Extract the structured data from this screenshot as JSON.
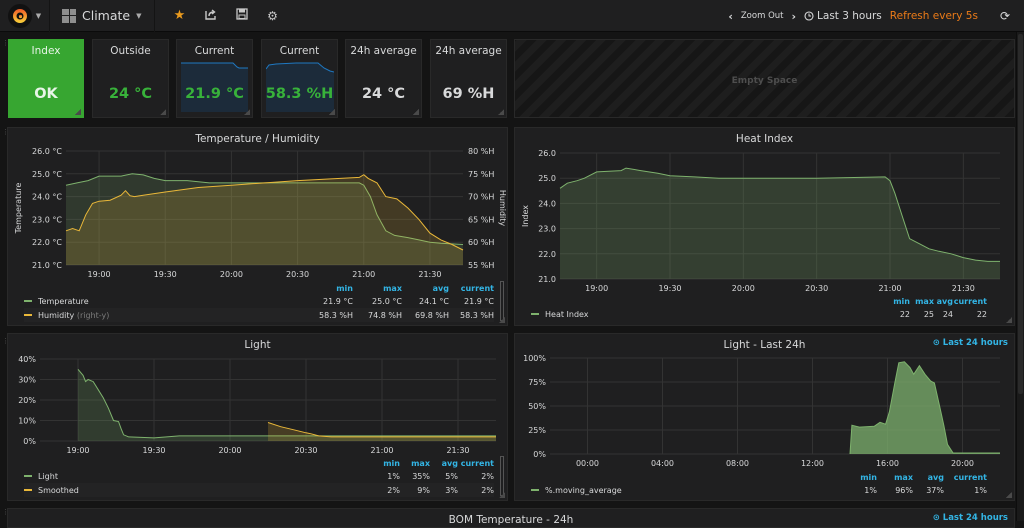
{
  "navbar": {
    "dashboard_title": "Climate",
    "zoom_out_label": "Zoom Out",
    "time_range": "Last 3 hours",
    "refresh": "Refresh every 5s",
    "icons": [
      "grafana-logo-icon",
      "dashboard-grid-icon",
      "star-icon",
      "share-icon",
      "save-icon",
      "settings-gear-icon",
      "chevron-left-icon",
      "chevron-right-icon",
      "clock-icon",
      "refresh-icon"
    ]
  },
  "stats": [
    {
      "title": "Index",
      "value": "OK",
      "style": "green-bg"
    },
    {
      "title": "Outside",
      "value": "24 °C",
      "style": "green-text"
    },
    {
      "title": "Current",
      "value": "21.9 °C",
      "style": "green-text-sparkline"
    },
    {
      "title": "Current",
      "value": "58.3 %H",
      "style": "green-text-sparkline"
    },
    {
      "title": "24h average",
      "value": "24 °C",
      "style": "white-text"
    },
    {
      "title": "24h average",
      "value": "69 %H",
      "style": "white-text"
    }
  ],
  "empty_space": {
    "label": "Empty Space"
  },
  "colors": {
    "green": "#7eb26d",
    "yellow": "#eab839",
    "accent": "#33b5e5",
    "ok_green": "#37a631",
    "refresh_orange": "#eb7b18"
  },
  "legend_headers": {
    "min": "min",
    "max": "max",
    "avg": "avg",
    "current": "current"
  },
  "temp_humidity": {
    "title": "Temperature / Humidity",
    "legend": [
      {
        "name": "Temperature",
        "suffix": "",
        "min": "21.9 °C",
        "max": "25.0 °C",
        "avg": "24.1 °C",
        "current": "21.9 °C"
      },
      {
        "name": "Humidity",
        "suffix": "(right-y)",
        "min": "58.3 %H",
        "max": "74.8 %H",
        "avg": "69.8 %H",
        "current": "58.3 %H"
      }
    ]
  },
  "heat_index": {
    "title": "Heat Index",
    "legend": [
      {
        "name": "Heat Index",
        "min": "22",
        "max": "25",
        "avg": "24",
        "current": "22"
      }
    ]
  },
  "light": {
    "title": "Light",
    "legend": [
      {
        "name": "Light",
        "min": "1%",
        "max": "35%",
        "avg": "5%",
        "current": "2%"
      },
      {
        "name": "Smoothed",
        "min": "2%",
        "max": "9%",
        "avg": "3%",
        "current": "2%"
      }
    ]
  },
  "light_24h": {
    "title": "Light - Last 24h",
    "range": "Last 24 hours",
    "legend": [
      {
        "name": "%.moving_average",
        "min": "1%",
        "max": "96%",
        "avg": "37%",
        "current": "1%"
      }
    ]
  },
  "bom_temp": {
    "title": "BOM Temperature - 24h",
    "range": "Last 24 hours"
  },
  "chart_data": [
    {
      "type": "area",
      "title": "Temperature / Humidity",
      "ylabel": "Temperature",
      "y2label": "Humidity",
      "ylim": [
        21,
        26
      ],
      "y2lim": [
        55,
        80
      ],
      "yticks": [
        "26.0 °C",
        "25.0 °C",
        "24.0 °C",
        "23.0 °C",
        "22.0 °C",
        "21.0 °C"
      ],
      "y2ticks": [
        "80 %H",
        "75 %H",
        "70 %H",
        "65 %H",
        "60 %H",
        "55 %H"
      ],
      "xticks": [
        "19:00",
        "19:30",
        "20:00",
        "20:30",
        "21:00",
        "21:30"
      ],
      "xrange_min": [
        -15,
        165
      ],
      "series": [
        {
          "name": "Temperature",
          "axis": "left",
          "color": "#7eb26d",
          "x": [
            -15,
            -10,
            -5,
            0,
            10,
            15,
            20,
            25,
            30,
            40,
            50,
            60,
            90,
            118,
            120,
            123,
            126,
            130,
            134,
            140,
            145,
            150,
            155,
            165
          ],
          "y": [
            24.5,
            24.6,
            24.7,
            24.9,
            24.9,
            25.0,
            24.95,
            24.8,
            24.7,
            24.7,
            24.6,
            24.6,
            24.6,
            24.6,
            24.5,
            24.0,
            23.2,
            22.5,
            22.3,
            22.2,
            22.1,
            22.0,
            21.95,
            21.9
          ]
        },
        {
          "name": "Humidity",
          "axis": "right",
          "color": "#eab839",
          "x": [
            -15,
            -12,
            -9,
            -6,
            -3,
            0,
            5,
            10,
            12,
            14,
            16,
            20,
            30,
            45,
            60,
            90,
            118,
            120,
            122,
            126,
            130,
            135,
            140,
            145,
            150,
            155,
            160,
            165
          ],
          "y": [
            62.5,
            63,
            62.5,
            66,
            68.5,
            69,
            69.2,
            70.3,
            71.3,
            70.2,
            70,
            70.3,
            71,
            72,
            72.5,
            73.5,
            74.2,
            74.8,
            74,
            73,
            70,
            69.5,
            67.5,
            65,
            62,
            60.5,
            59.5,
            58.3
          ]
        }
      ]
    },
    {
      "type": "area",
      "title": "Heat Index",
      "ylabel": "Index",
      "ylim": [
        21,
        26
      ],
      "yticks": [
        "26.0",
        "25.0",
        "24.0",
        "23.0",
        "22.0",
        "21.0"
      ],
      "xticks": [
        "19:00",
        "19:30",
        "20:00",
        "20:30",
        "21:00",
        "21:30"
      ],
      "xrange_min": [
        -15,
        165
      ],
      "series": [
        {
          "name": "Heat Index",
          "color": "#7eb26d",
          "x": [
            -15,
            -12,
            -8,
            -5,
            0,
            10,
            12,
            18,
            25,
            30,
            40,
            50,
            60,
            90,
            118,
            120,
            122,
            125,
            128,
            132,
            136,
            140,
            145,
            150,
            155,
            160,
            165
          ],
          "y": [
            24.6,
            24.8,
            24.9,
            25.0,
            25.25,
            25.3,
            25.4,
            25.3,
            25.2,
            25.1,
            25.05,
            25.0,
            25.0,
            25.0,
            25.05,
            24.9,
            24.4,
            23.5,
            22.6,
            22.4,
            22.2,
            22.1,
            22.0,
            21.85,
            21.75,
            21.7,
            21.7
          ]
        }
      ]
    },
    {
      "type": "area",
      "title": "Light",
      "ylim": [
        0,
        40
      ],
      "yticks": [
        "40%",
        "30%",
        "20%",
        "10%",
        "0%"
      ],
      "xticks": [
        "19:00",
        "19:30",
        "20:00",
        "20:30",
        "21:00",
        "21:30"
      ],
      "xrange_min": [
        -15,
        165
      ],
      "series": [
        {
          "name": "Light",
          "color": "#7eb26d",
          "x": [
            0,
            2,
            3,
            4,
            6,
            8,
            10,
            12,
            14,
            16,
            17,
            18,
            20,
            30,
            40,
            60,
            90,
            120,
            165
          ],
          "y": [
            35,
            32,
            29,
            30,
            29,
            25,
            21,
            16,
            10,
            9.5,
            6,
            3,
            2,
            1.5,
            2.5,
            2.5,
            2.5,
            2.5,
            2.5
          ]
        },
        {
          "name": "Smoothed",
          "color": "#eab839",
          "x": [
            75,
            80,
            85,
            90,
            92,
            95,
            100,
            120,
            165
          ],
          "y": [
            9,
            7,
            5.5,
            4,
            3.5,
            2.5,
            2,
            2,
            2
          ]
        }
      ]
    },
    {
      "type": "area",
      "title": "Light - Last 24h",
      "ylim": [
        0,
        100
      ],
      "yticks": [
        "100%",
        "75%",
        "50%",
        "25%",
        "0%"
      ],
      "xticks": [
        "00:00",
        "04:00",
        "08:00",
        "12:00",
        "16:00",
        "20:00"
      ],
      "xrange_hours": [
        -2,
        22
      ],
      "series": [
        {
          "name": "%.moving_average",
          "color": "#7eb26d",
          "x": [
            14.0,
            14.1,
            14.5,
            15.3,
            15.6,
            15.9,
            16.1,
            16.4,
            16.6,
            16.9,
            17.2,
            17.4,
            17.7,
            18.0,
            18.3,
            18.5,
            18.8,
            19.0,
            19.2,
            19.5,
            20.0,
            22.0
          ],
          "y": [
            0,
            30,
            28,
            29,
            33,
            31,
            44,
            75,
            95,
            96,
            90,
            83,
            92,
            83,
            76,
            74,
            48,
            30,
            10,
            1,
            1,
            1
          ]
        }
      ]
    }
  ]
}
